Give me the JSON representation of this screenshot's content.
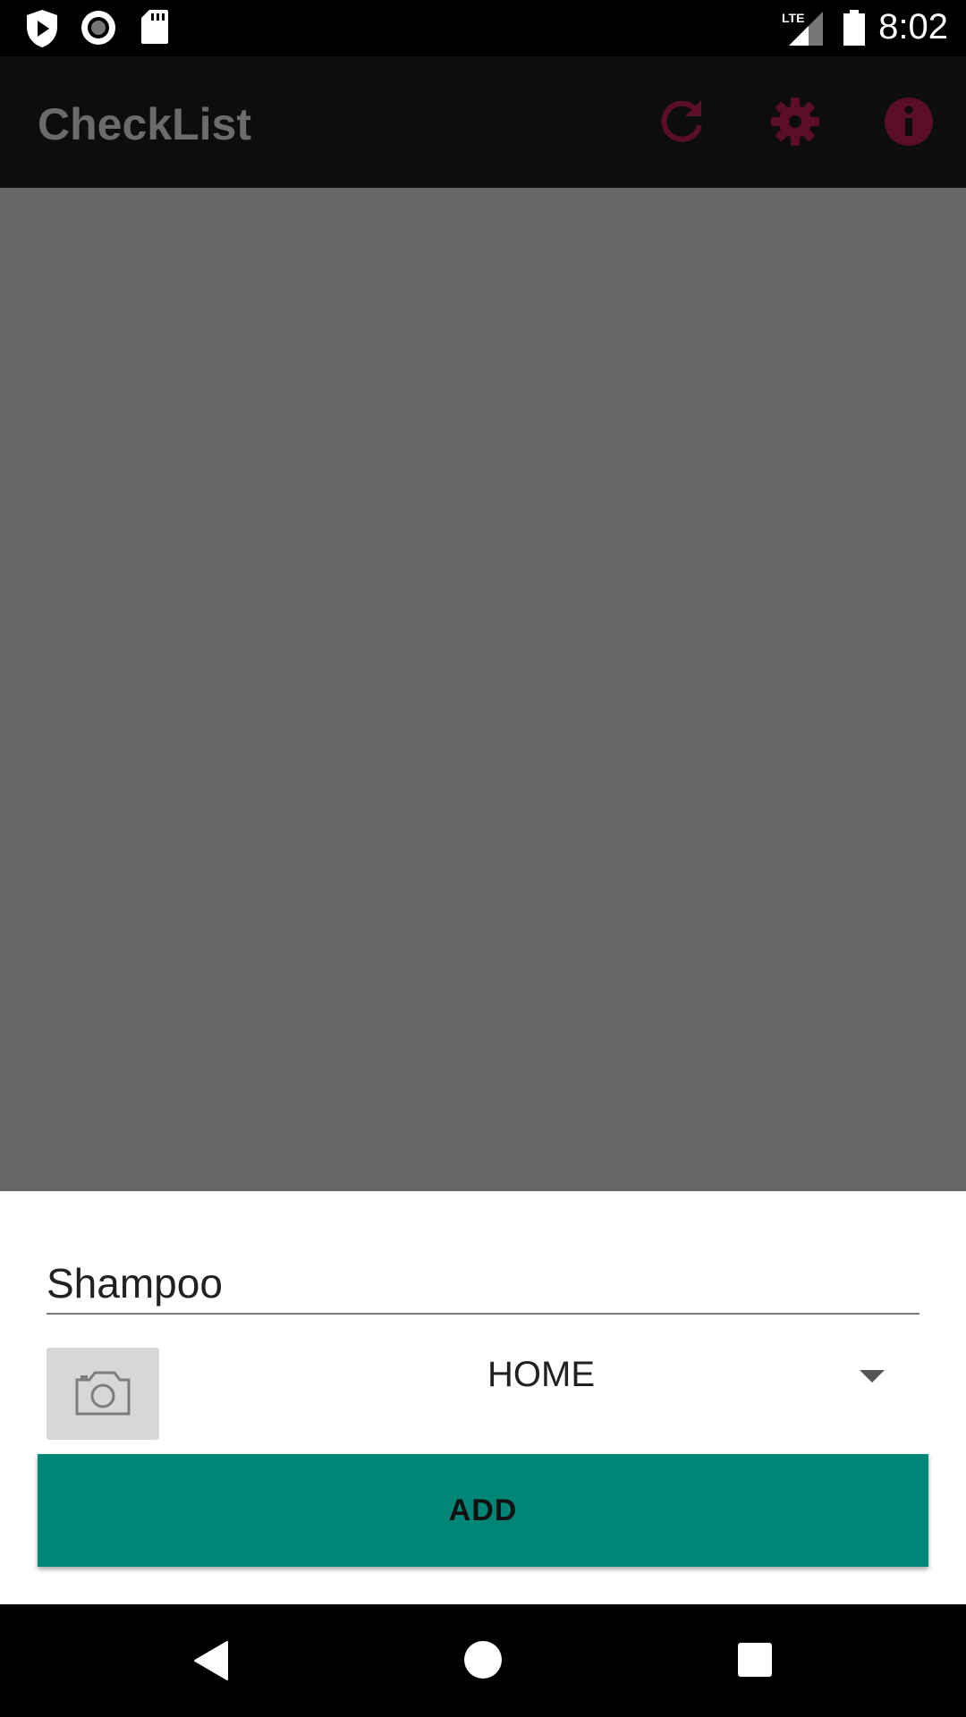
{
  "status_bar": {
    "time": "8:02",
    "network_label": "LTE",
    "icons": [
      "shield-play-icon",
      "record-icon",
      "sd-card-icon",
      "signal-icon",
      "battery-icon"
    ]
  },
  "app_bar": {
    "title": "CheckList",
    "actions": [
      "refresh-icon",
      "settings-gear-icon",
      "info-icon"
    ],
    "action_color": "#5a0f26"
  },
  "add_item_sheet": {
    "item_name_value": "Shampoo",
    "item_name_placeholder": "",
    "category_selected": "HOME",
    "add_button_label": "ADD",
    "add_button_color": "#008577"
  },
  "nav_bar": {
    "buttons": [
      "back-icon",
      "home-icon",
      "recents-icon"
    ]
  }
}
